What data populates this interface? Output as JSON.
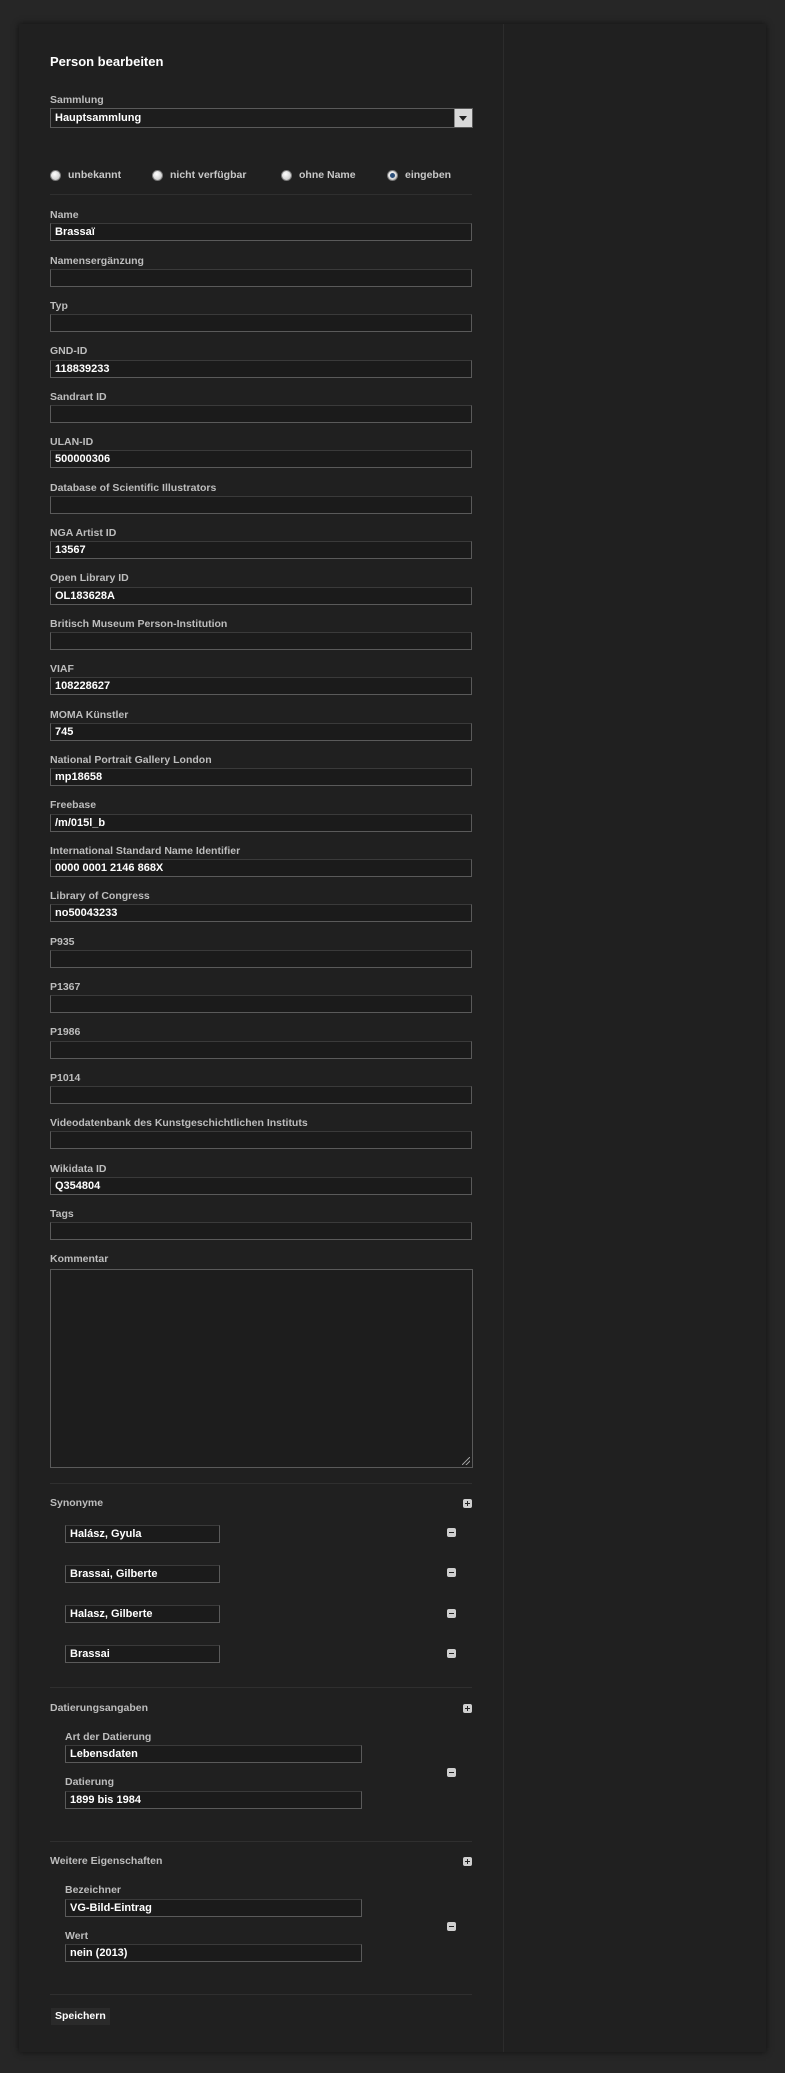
{
  "page": {
    "title": "Person bearbeiten"
  },
  "collection": {
    "label": "Sammlung",
    "value": "Hauptsammlung"
  },
  "name_mode": {
    "options": [
      "unbekannt",
      "nicht verfügbar",
      "ohne Name",
      "eingeben"
    ],
    "selected": "eingeben"
  },
  "fields": {
    "name": {
      "label": "Name",
      "value": "Brassaï"
    },
    "name_addition": {
      "label": "Namensergänzung",
      "value": ""
    },
    "type": {
      "label": "Typ",
      "value": ""
    },
    "gnd": {
      "label": "GND-ID",
      "value": "118839233"
    },
    "sandrart": {
      "label": "Sandrart ID",
      "value": ""
    },
    "ulan": {
      "label": "ULAN-ID",
      "value": "500000306"
    },
    "dsi": {
      "label": "Database of Scientific Illustrators",
      "value": ""
    },
    "nga": {
      "label": "NGA Artist ID",
      "value": "13567"
    },
    "openlibrary": {
      "label": "Open Library ID",
      "value": "OL183628A"
    },
    "britishmuseum": {
      "label": "Britisch Museum Person-Institution",
      "value": ""
    },
    "viaf": {
      "label": "VIAF",
      "value": "108228627"
    },
    "moma": {
      "label": "MOMA Künstler",
      "value": "745"
    },
    "npg": {
      "label": "National Portrait Gallery London",
      "value": "mp18658"
    },
    "freebase": {
      "label": "Freebase",
      "value": "/m/015l_b"
    },
    "isni": {
      "label": "International Standard Name Identifier",
      "value": "0000 0001 2146 868X"
    },
    "loc": {
      "label": "Library of Congress",
      "value": "no50043233"
    },
    "p935": {
      "label": "P935",
      "value": ""
    },
    "p1367": {
      "label": "P1367",
      "value": ""
    },
    "p1986": {
      "label": "P1986",
      "value": ""
    },
    "p1014": {
      "label": "P1014",
      "value": ""
    },
    "videodb": {
      "label": "Videodatenbank des Kunstgeschichtlichen Instituts",
      "value": ""
    },
    "wikidata": {
      "label": "Wikidata ID",
      "value": "Q354804"
    },
    "tags": {
      "label": "Tags",
      "value": ""
    }
  },
  "comment": {
    "label": "Kommentar",
    "value": ""
  },
  "synonyms": {
    "title": "Synonyme",
    "items": [
      "Halász, Gyula",
      "Brassai, Gilberte",
      "Halasz, Gilberte",
      "Brassai"
    ]
  },
  "dating": {
    "title": "Datierungsangaben",
    "type_label": "Art der Datierung",
    "type_value": "Lebensdaten",
    "date_label": "Datierung",
    "date_value": "1899 bis 1984"
  },
  "properties": {
    "title": "Weitere Eigenschaften",
    "name_label": "Bezeichner",
    "name_value": "VG-Bild-Eintrag",
    "value_label": "Wert",
    "value_value": "nein (2013)"
  },
  "actions": {
    "save": "Speichern"
  },
  "icons": {
    "add": "plus-icon",
    "remove": "minus-icon",
    "resize": "resize-grip-icon",
    "dropdown": "chevron-down-icon"
  }
}
